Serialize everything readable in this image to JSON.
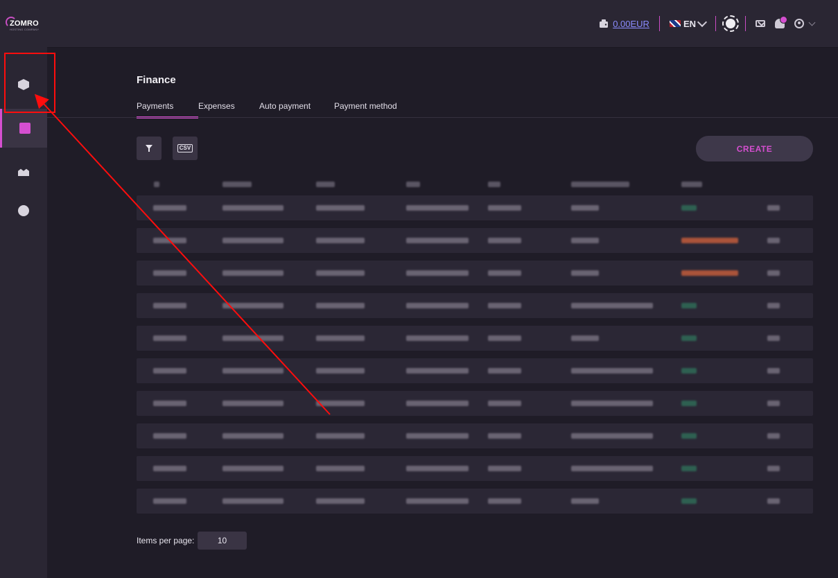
{
  "brand": {
    "name": "ZOMRO",
    "tagline": "HOSTING COMPANY"
  },
  "header": {
    "balance": "0.00EUR",
    "language": "EN",
    "icons": [
      "wallet-icon",
      "flag-uk-icon",
      "theme-sun-icon",
      "mail-icon",
      "bell-icon",
      "user-icon"
    ]
  },
  "sidebar": {
    "items": [
      {
        "name": "services",
        "icon": "box-icon",
        "active": false
      },
      {
        "name": "finance",
        "icon": "wallet-icon",
        "active": true
      },
      {
        "name": "users",
        "icon": "users-icon",
        "active": false
      },
      {
        "name": "support",
        "icon": "support-icon",
        "active": false
      }
    ]
  },
  "main": {
    "title": "Finance",
    "tabs": [
      {
        "label": "Payments",
        "active": true
      },
      {
        "label": "Expenses",
        "active": false
      },
      {
        "label": "Auto payment",
        "active": false
      },
      {
        "label": "Payment method",
        "active": false
      }
    ],
    "toolbar": {
      "csv_label": "CSV",
      "create_label": "CREATE"
    },
    "table": {
      "rows": [
        {
          "status": "green"
        },
        {
          "status": "orange"
        },
        {
          "status": "orange"
        },
        {
          "status": "green"
        },
        {
          "status": "green"
        },
        {
          "status": "green"
        },
        {
          "status": "green"
        },
        {
          "status": "green"
        },
        {
          "status": "green"
        },
        {
          "status": "green"
        }
      ]
    },
    "pagination": {
      "items_per_page_label": "Items per page:",
      "items_per_page_value": "10"
    }
  },
  "colors": {
    "accent": "#d54fd0",
    "background": "#1f1c27",
    "panel": "#2a2633",
    "annotation": "#ff0d0d"
  }
}
